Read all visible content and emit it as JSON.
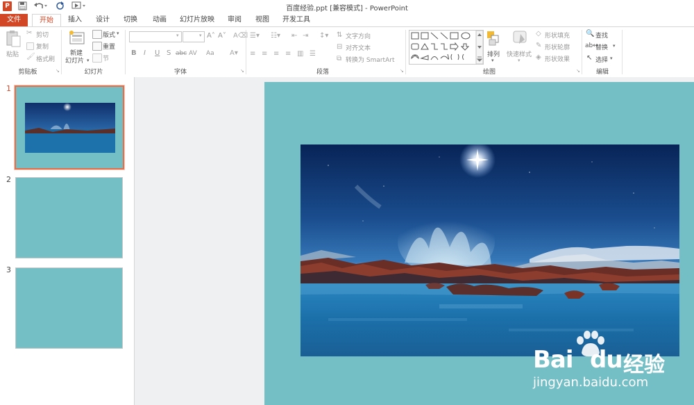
{
  "window": {
    "title": "百度经验.ppt [兼容模式] - PowerPoint",
    "app_badge": "P"
  },
  "tabs": [
    "文件",
    "开始",
    "插入",
    "设计",
    "切换",
    "动画",
    "幻灯片放映",
    "审阅",
    "视图",
    "开发工具"
  ],
  "active_tab": "开始",
  "ribbon": {
    "clipboard": {
      "paste": "粘贴",
      "cut": "剪切",
      "copy": "复制",
      "format_painter": "格式刷",
      "label": "剪贴板"
    },
    "slides": {
      "new_slide_line1": "新建",
      "new_slide_line2": "幻灯片",
      "layout": "版式",
      "reset": "重置",
      "section": "节",
      "label": "幻灯片"
    },
    "font": {
      "bold": "B",
      "italic": "I",
      "underline": "U",
      "strike": "S",
      "shadow": "abc",
      "spacing": "AV",
      "case": "Aa",
      "label": "字体"
    },
    "paragraph": {
      "text_direction": "文字方向",
      "align_text": "对齐文本",
      "smartart": "转换为 SmartArt",
      "label": "段落"
    },
    "drawing": {
      "arrange": "排列",
      "quick_styles": "快速样式",
      "shape_fill": "形状填充",
      "shape_outline": "形状轮廓",
      "shape_effects": "形状效果",
      "label": "绘图"
    },
    "editing": {
      "find": "查找",
      "replace": "替换",
      "select": "选择",
      "label": "编辑"
    }
  },
  "slides_panel": {
    "numbers": [
      "1",
      "2",
      "3"
    ],
    "selected": 1
  },
  "slide": {
    "background": "#74bec5",
    "image": "night sky glacier lagoon photo"
  },
  "watermark": {
    "brand_latin": "Bai",
    "brand_latin2": "du",
    "brand_cn": "经验",
    "url": "jingyan.baidu.com"
  },
  "colors": {
    "accent": "#d24726",
    "slide_bg": "#74bec5",
    "selected_border": "#e2704b"
  }
}
